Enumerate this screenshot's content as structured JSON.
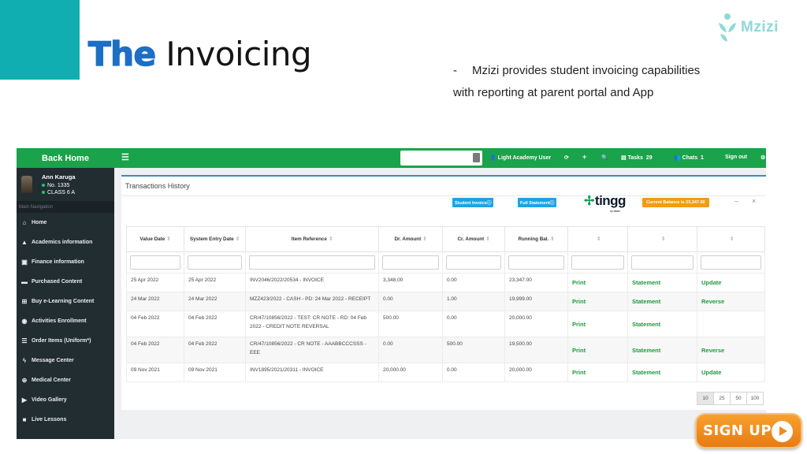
{
  "slide": {
    "title_the": "The",
    "title_rest": "Invoicing",
    "logo_text": "Mzizi",
    "description_dash": "-",
    "description": "Mzizi provides student invoicing capabilities with reporting at parent portal and App",
    "signup_label": "SIGN UP"
  },
  "app": {
    "sidebar": {
      "back_home": "Back Home",
      "user_name": "Ann Karuga",
      "user_no": "No. 1335",
      "user_class": "CLASS 6 A",
      "main_nav_label": "Main Navigation",
      "items": [
        {
          "label": "Home",
          "icon": "home-icon"
        },
        {
          "label": "Academics information",
          "icon": "graduation-cap-icon"
        },
        {
          "label": "Finance information",
          "icon": "money-icon"
        },
        {
          "label": "Purchased Content",
          "icon": "folder-icon"
        },
        {
          "label": "Buy e-Learning Content",
          "icon": "cart-icon"
        },
        {
          "label": "Activities Enrollment",
          "icon": "circle-icon"
        },
        {
          "label": "Order Items (Uniform*)",
          "icon": "list-icon"
        },
        {
          "label": "Message Center",
          "icon": "bolt-icon"
        },
        {
          "label": "Medical Center",
          "icon": "medical-icon"
        },
        {
          "label": "Video Gallery",
          "icon": "video-icon"
        },
        {
          "label": "Live Lessons",
          "icon": "camera-icon"
        }
      ]
    },
    "topbar": {
      "user_label": "Light Academy User",
      "tasks_label": "Tasks",
      "tasks_count": "29",
      "chats_label": "Chats",
      "chats_count": "1",
      "signout_label": "Sign out"
    },
    "panel": {
      "title": "Transactions History",
      "student_invoice_btn": "Student Invoiceⓘ",
      "full_statement_btn": "Full Statementⓘ",
      "tingg_logo": "tingg",
      "tingg_sub": "by Cellulant",
      "balance": "Current Balance is 23,347.00",
      "minimize": "–",
      "close": "×"
    },
    "table": {
      "headers": [
        "Value Date",
        "System Entry Date",
        "Item Reference",
        "Dr. Amount",
        "Cr. Amount",
        "Running Bal.",
        "",
        "",
        ""
      ],
      "rows": [
        {
          "value_date": "25 Apr 2022",
          "entry_date": "25 Apr 2022",
          "reference": "INV2046/2022/20534 - INVOICE",
          "dr": "3,348.00",
          "cr": "0.00",
          "bal": "23,347.00",
          "a1": "Print",
          "a2": "Statement",
          "a3": "Update"
        },
        {
          "value_date": "24 Mar 2022",
          "entry_date": "24 Mar 2022",
          "reference": "MZZ423/2022 - CASH - PD: 24 Mar 2022 - RECEIPT",
          "dr": "0.00",
          "cr": "1.00",
          "bal": "19,999.00",
          "a1": "Print",
          "a2": "Statement",
          "a3": "Reverse"
        },
        {
          "value_date": "04 Feb 2022",
          "entry_date": "04 Feb 2022",
          "reference": "CR/47/10856/2022 - TEST: CR NOTE - RD: 04 Feb 2022 - CREDIT NOTE REVERSAL",
          "dr": "500.00",
          "cr": "0.00",
          "bal": "20,000.00",
          "a1": "Print",
          "a2": "Statement",
          "a3": ""
        },
        {
          "value_date": "04 Feb 2022",
          "entry_date": "04 Feb 2022",
          "reference": "CR/47/10856/2022 - CR NOTE - AAABBCCCSSS - EEE",
          "dr": "0.00",
          "cr": "500.00",
          "bal": "19,500.00",
          "a1": "Print",
          "a2": "Statement",
          "a3": "Reverse"
        },
        {
          "value_date": "09 Nov 2021",
          "entry_date": "09 Nov 2021",
          "reference": "INV1895/2021/20311 - INVOICE",
          "dr": "20,000.00",
          "cr": "0.00",
          "bal": "20,000.00",
          "a1": "Print",
          "a2": "Statement",
          "a3": "Update"
        }
      ]
    },
    "pager": [
      "10",
      "25",
      "50",
      "100"
    ],
    "colors": {
      "green": "#1aa34a",
      "sidebar": "#222d32",
      "orange": "#f39c12",
      "blue": "#1fa3e6",
      "teal": "#10aeb0"
    }
  }
}
